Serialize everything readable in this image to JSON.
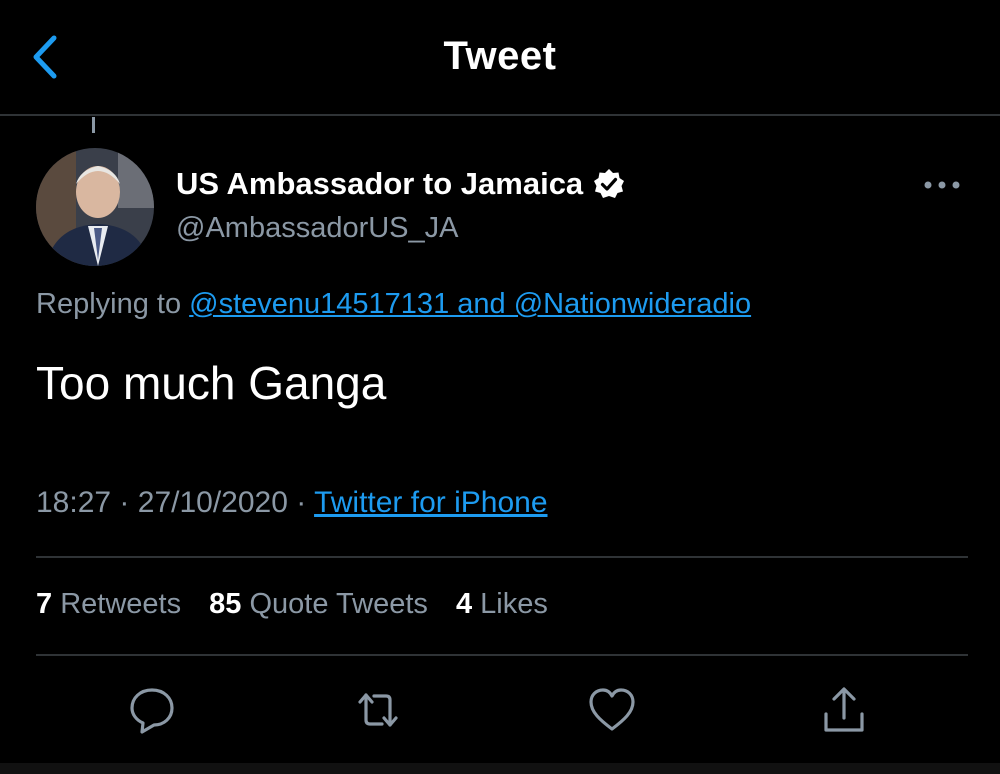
{
  "header": {
    "title": "Tweet"
  },
  "author": {
    "name": "US Ambassador to Jamaica",
    "handle": "@AmbassadorUS_JA",
    "verified": true
  },
  "reply": {
    "prefix": "Replying to",
    "mentions": "@stevenu14517131 and @Nationwideradio"
  },
  "tweet": {
    "text": "Too much Ganga"
  },
  "meta": {
    "time": "18:27",
    "date": "27/10/2020",
    "source": "Twitter for iPhone",
    "separator": "·"
  },
  "stats": {
    "retweets_count": "7",
    "retweets_label": "Retweets",
    "quotes_count": "85",
    "quotes_label": "Quote Tweets",
    "likes_count": "4",
    "likes_label": "Likes"
  },
  "actions": [
    "reply-icon",
    "retweet-icon",
    "like-icon",
    "share-icon"
  ],
  "colors": {
    "accent": "#1d9bf0",
    "muted": "#8b98a5",
    "background": "#000000"
  }
}
